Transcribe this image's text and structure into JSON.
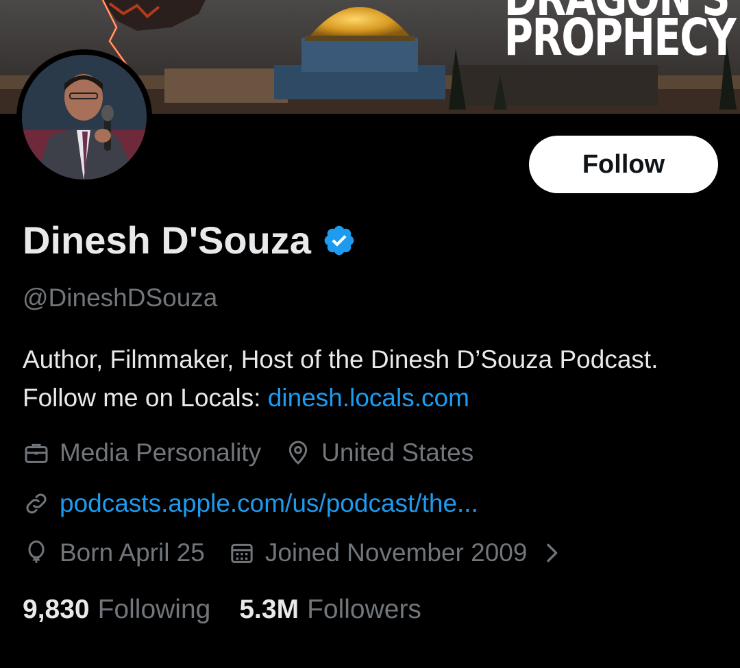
{
  "banner": {
    "title_top": "DRAGON'S",
    "title_bottom": "PROPHECY"
  },
  "profile": {
    "name": "Dinesh D'Souza",
    "handle": "@DineshDSouza",
    "bio_text": "Author, Filmmaker, Host of the Dinesh D’Souza Podcast. Follow me on Locals: ",
    "bio_link": "dinesh.locals.com",
    "follow_label": "Follow"
  },
  "meta": {
    "category": "Media Personality",
    "location": "United States",
    "website": "podcasts.apple.com/us/podcast/the...",
    "birthday": "Born April 25",
    "joined": "Joined November 2009"
  },
  "stats": {
    "following_count": "9,830",
    "following_label": "Following",
    "followers_count": "5.3M",
    "followers_label": "Followers"
  },
  "colors": {
    "accent": "#1d9bf0",
    "muted": "#71767b",
    "text": "#e7e9ea",
    "background": "#000000"
  },
  "icons": [
    "briefcase-icon",
    "location-pin-icon",
    "link-icon",
    "balloon-icon",
    "calendar-icon",
    "chevron-right-icon",
    "verified-badge-icon"
  ]
}
